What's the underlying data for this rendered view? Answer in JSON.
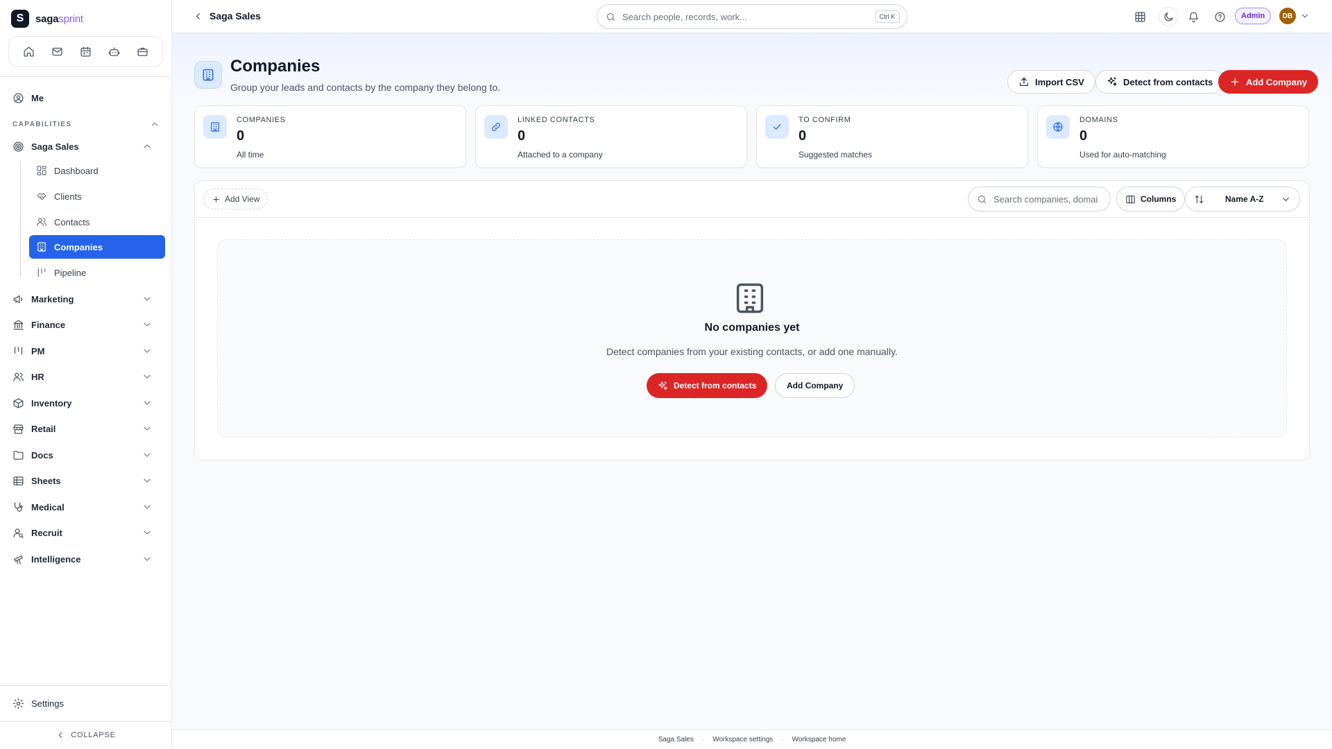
{
  "brand": {
    "name_main": "saga",
    "name_accent": "sprint"
  },
  "quick_nav": [
    "home-icon",
    "mail-icon",
    "calendar-icon",
    "bot-icon",
    "briefcase-icon"
  ],
  "sidebar": {
    "me_label": "Me",
    "capabilities_label": "CAPABILITIES",
    "saga_sales": {
      "label": "Saga Sales",
      "items": [
        {
          "label": "Dashboard",
          "icon": "dashboard-icon"
        },
        {
          "label": "Clients",
          "icon": "handshake-icon"
        },
        {
          "label": "Contacts",
          "icon": "users-icon"
        },
        {
          "label": "Companies",
          "icon": "building-icon",
          "active": true
        },
        {
          "label": "Pipeline",
          "icon": "pipeline-icon"
        }
      ]
    },
    "groups": [
      {
        "label": "Marketing",
        "icon": "megaphone-icon"
      },
      {
        "label": "Finance",
        "icon": "bank-icon"
      },
      {
        "label": "PM",
        "icon": "kanban-icon"
      },
      {
        "label": "HR",
        "icon": "people-icon"
      },
      {
        "label": "Inventory",
        "icon": "box-icon"
      },
      {
        "label": "Retail",
        "icon": "store-icon"
      },
      {
        "label": "Docs",
        "icon": "folder-icon"
      },
      {
        "label": "Sheets",
        "icon": "table-icon"
      },
      {
        "label": "Medical",
        "icon": "stethoscope-icon"
      },
      {
        "label": "Recruit",
        "icon": "user-search-icon"
      },
      {
        "label": "Intelligence",
        "icon": "telescope-icon"
      }
    ],
    "settings_label": "Settings",
    "collapse_label": "COLLAPSE"
  },
  "topbar": {
    "title": "Saga Sales",
    "search_placeholder": "Search people, records, work...",
    "search_shortcut": "Ctrl K",
    "admin_label": "Admin",
    "avatar_initials": "DB"
  },
  "header": {
    "title": "Companies",
    "subtitle": "Group your leads and contacts by the company they belong to.",
    "import_label": "Import CSV",
    "detect_label": "Detect from contacts",
    "add_label": "Add Company"
  },
  "stats": [
    {
      "label": "COMPANIES",
      "value": "0",
      "caption": "All time",
      "icon": "building-icon",
      "color": "#2563eb",
      "bg": "#dbeafe"
    },
    {
      "label": "LINKED CONTACTS",
      "value": "0",
      "caption": "Attached to a company",
      "icon": "link-icon",
      "color": "#2563eb",
      "bg": "#dbeafe"
    },
    {
      "label": "TO CONFIRM",
      "value": "0",
      "caption": "Suggested matches",
      "icon": "check-icon",
      "color": "#2563eb",
      "bg": "#dbeafe"
    },
    {
      "label": "DOMAINS",
      "value": "0",
      "caption": "Used for auto-matching",
      "icon": "globe-icon",
      "color": "#2563eb",
      "bg": "#dbeafe"
    }
  ],
  "toolbar": {
    "add_view_label": "Add View",
    "search_placeholder": "Search companies, domains",
    "columns_label": "Columns",
    "sort_label": "Name A-Z"
  },
  "empty_state": {
    "title": "No companies yet",
    "description": "Detect companies from your existing contacts, or add one manually.",
    "detect_label": "Detect from contacts",
    "add_label": "Add Company"
  },
  "footer": {
    "links": [
      "Saga Sales",
      "Workspace settings",
      "Workspace home"
    ]
  },
  "colors": {
    "accent": "#2563eb",
    "primary_action": "#dc2626",
    "brand_accent": "#8b5cf6"
  }
}
